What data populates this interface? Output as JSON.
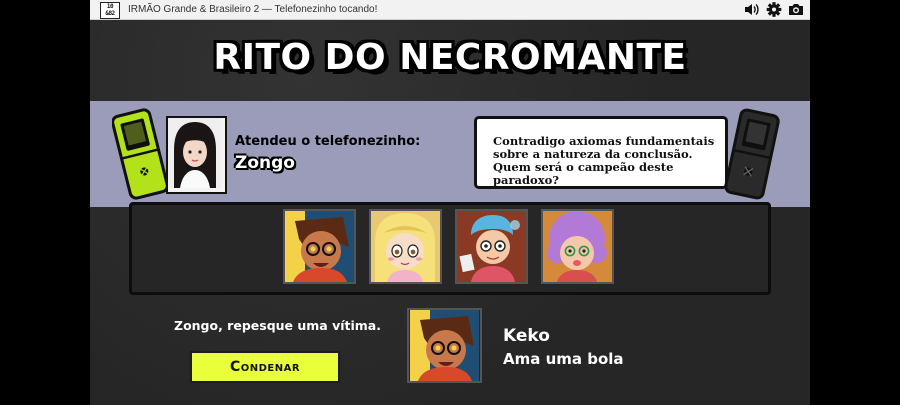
{
  "titlebar": {
    "logo_lines": [
      "10",
      "&82"
    ],
    "window_title": "IRMÃO Grande & Brasileiro 2 — Telefonezinho tocando!",
    "icons": [
      "speaker-icon",
      "gear-icon",
      "camera-icon"
    ]
  },
  "screen": {
    "title": "RITO DO NECROMANTE"
  },
  "call": {
    "answered_label": "Atendeu o telefonezinho:",
    "caller_name": "Zongo",
    "question": "Contradigo axiomas fundamentais sobre a natureza da conclusão. Quem será o campeão deste paradoxo?"
  },
  "victims": [
    {
      "id": "keko"
    },
    {
      "id": "blonde-girl"
    },
    {
      "id": "blue-hair-boy"
    },
    {
      "id": "purple-hair-girl"
    }
  ],
  "action": {
    "instruction": "Zongo, repesque uma vítima.",
    "button_label": "Condenar"
  },
  "selected": {
    "name": "Keko",
    "trait": "Ama uma bola"
  },
  "colors": {
    "band": "#9a9cb9",
    "button": "#e8ff3a",
    "phone_left": "#b4e21a",
    "phone_right": "#2a2a2a"
  }
}
